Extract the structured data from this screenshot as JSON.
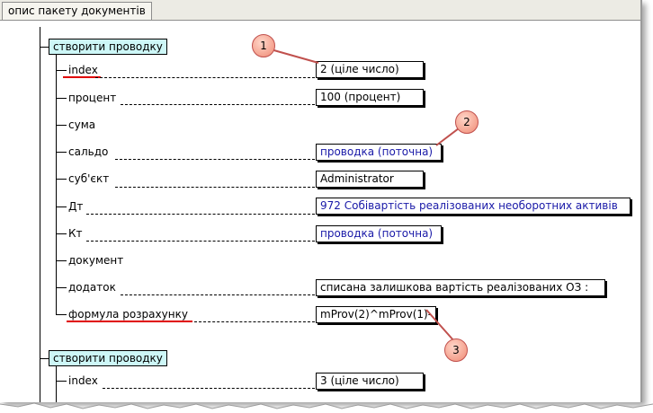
{
  "tab": {
    "label": "опис пакету документів"
  },
  "nodes": [
    {
      "label": "створити проводку"
    },
    {
      "label": "створити проводку"
    }
  ],
  "fields": [
    {
      "label": "index",
      "value": "2  (ціле число)"
    },
    {
      "label": "процент",
      "value": "100  (процент)"
    },
    {
      "label": "сума",
      "value": ""
    },
    {
      "label": "сальдо",
      "value": "проводка (поточна)"
    },
    {
      "label": "суб'єкт",
      "value": "Administrator"
    },
    {
      "label": "Дт",
      "value": "972 Собівартість реалізованих необоротних активів"
    },
    {
      "label": "Кт",
      "value": "проводка (поточна)"
    },
    {
      "label": "документ",
      "value": ""
    },
    {
      "label": "додаток",
      "value": "списана залишкова вартість реалізованих ОЗ :"
    },
    {
      "label": "формула розрахунку",
      "value": "mProv(2)^mProv(1)-"
    },
    {
      "label": "index",
      "value": "3  (ціле число)"
    }
  ],
  "callouts": [
    "1",
    "2",
    "3"
  ],
  "colors": {
    "node_bg": "#cdf7f7",
    "link_text": "#1a1aa8",
    "underline": "#e00000",
    "callout_fill": "#f08a74"
  }
}
